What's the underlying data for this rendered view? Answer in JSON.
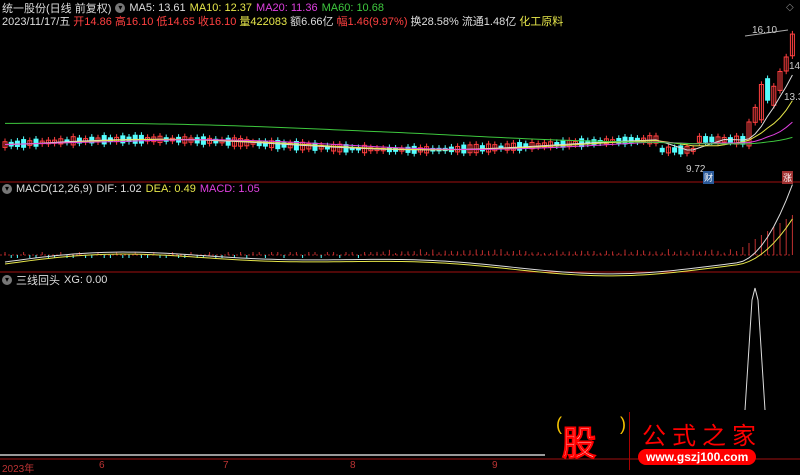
{
  "header": {
    "stock": "统一股份(日线 前复权)",
    "ma5": "MA5: 13.61",
    "ma10": "MA10: 12.37",
    "ma20": "MA20: 11.36",
    "ma60": "MA60: 10.68",
    "date": "2023/11/17/五",
    "open": "开14.86",
    "high": "高16.10",
    "low": "低14.65",
    "close": "收16.10",
    "volume": "量422083",
    "amount": "额6.66亿",
    "change": "幅1.46(9.97%)",
    "turnover": "换28.58%",
    "float": "流通1.48亿",
    "industry": "化工原料"
  },
  "main_chart": {
    "high_label": "16.10",
    "label_14": "14",
    "label_13": "13.3",
    "low_label": "9.72",
    "badge_cai": "财",
    "badge_zhang": "涨"
  },
  "macd": {
    "title": "MACD(12,26,9)",
    "dif": "DIF: 1.02",
    "dea": "DEA: 0.49",
    "macd": "MACD: 1.05"
  },
  "xg": {
    "title": "三线回头",
    "value": "XG: 0.00"
  },
  "axis": {
    "labels": [
      "2023年",
      "6",
      "7",
      "8",
      "9"
    ]
  },
  "logo": {
    "char": "股",
    "name": "公式之家",
    "url": "www.gszj100.com"
  },
  "colors": {
    "up": "#ff4040",
    "down": "#54ffff",
    "ma5": "#dddddd",
    "ma10": "#e6e64a",
    "ma20": "#e040e0",
    "ma60": "#3ec83e"
  }
}
